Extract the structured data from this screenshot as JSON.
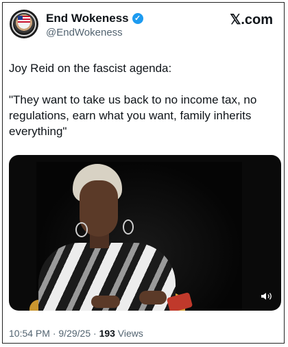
{
  "account": {
    "display_name": "End Wokeness",
    "handle": "@EndWokeness",
    "verified_icon": "verified-badge-icon",
    "verified_color": "#1d9bf0"
  },
  "brand": {
    "label": "𝕏.com"
  },
  "tweet": {
    "line1": "Joy Reid on the fascist agenda:",
    "line2": "\"They want to take us back to no income tax, no regulations, earn what you want, family inherits everything\""
  },
  "media": {
    "type": "video",
    "volume_icon": "volume-icon"
  },
  "meta": {
    "time": "10:54 PM",
    "separator": " · ",
    "date": "9/29/25",
    "views_count": "193",
    "views_label": " Views"
  },
  "colors": {
    "text": "#0f1419",
    "secondary": "#536471",
    "accent": "#1d9bf0"
  }
}
